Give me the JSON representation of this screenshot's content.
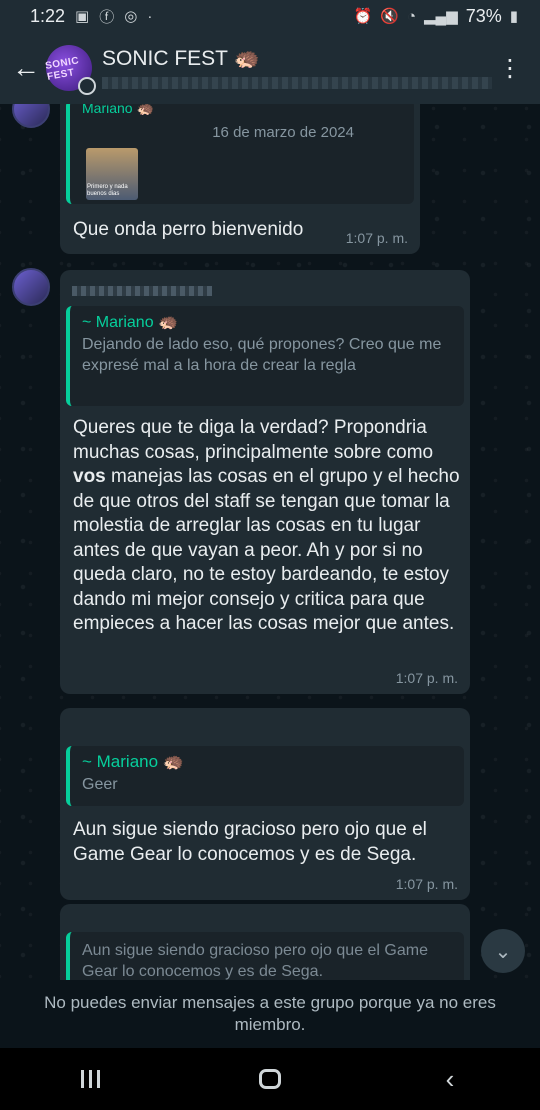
{
  "status_bar": {
    "time": "1:22",
    "battery": "73%"
  },
  "header": {
    "group_name": "SONIC FEST 🦔",
    "avatar_text": "SONIC FEST"
  },
  "messages": [
    {
      "reply_author": "Mariano 🦔",
      "date_in_quote": "16 de marzo de 2024",
      "sticker_caption": "Primero y nada buenos dias",
      "text": "Que onda perro bienvenido",
      "time": "1:07 p. m."
    },
    {
      "reply_author": "~ Mariano 🦔",
      "reply_text": "Dejando de lado eso, qué propones? Creo que me expresé mal a la hora de crear la regla",
      "text_before": "Queres que te diga la verdad? Propondria muchas cosas, principalmente sobre como ",
      "text_bold": "vos",
      "text_after": " manejas las cosas en el grupo y el hecho de que otros del staff se tengan que tomar la molestia de arreglar las cosas en tu lugar antes de que vayan a peor. Ah y por si no queda claro, no te estoy bardeando, te estoy dando mi mejor consejo y critica para que empieces a hacer las cosas mejor que antes.",
      "time": "1:07 p. m."
    },
    {
      "reply_author": "~ Mariano 🦔",
      "reply_text": "Geer",
      "text": "Aun sigue siendo gracioso pero ojo que el Game Gear lo conocemos y es de Sega.",
      "time": "1:07 p. m."
    },
    {
      "reply_text": "Aun sigue siendo gracioso pero ojo que el Game Gear lo conocemos y es de Sega."
    }
  ],
  "notice": "No puedes enviar mensajes a este grupo porque ya no eres miembro."
}
